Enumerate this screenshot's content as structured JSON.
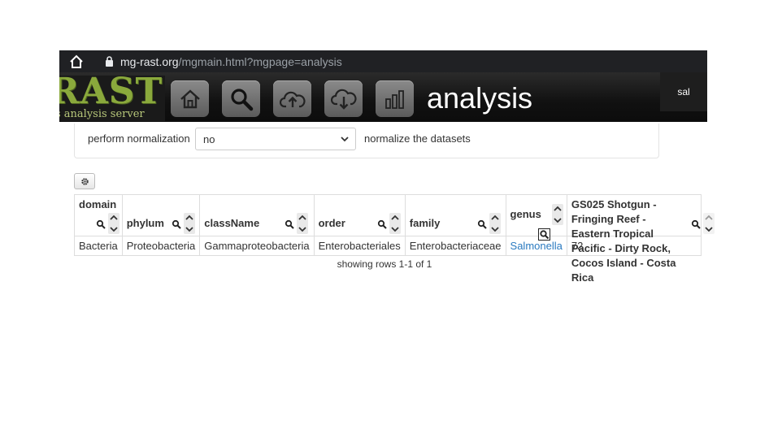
{
  "browser": {
    "url_host": "mg-rast.org",
    "url_path": "/mgmain.html?mgpage=analysis"
  },
  "header": {
    "logo_text": "RAST",
    "logo_subtitle": "s analysis server",
    "page_title": "analysis",
    "user": "sal",
    "nav_icons": [
      "home-icon",
      "search-icon",
      "upload-icon",
      "download-icon",
      "analysis-chart-icon"
    ]
  },
  "normalization": {
    "label": "perform normalization",
    "selected": "no",
    "description": "normalize the datasets"
  },
  "table": {
    "columns": [
      {
        "key": "domain",
        "label": "domain"
      },
      {
        "key": "phylum",
        "label": "phylum"
      },
      {
        "key": "className",
        "label": "className"
      },
      {
        "key": "order",
        "label": "order"
      },
      {
        "key": "family",
        "label": "family"
      },
      {
        "key": "genus",
        "label": "genus"
      },
      {
        "key": "sample",
        "label": "GS025 Shotgun - Fringing Reef - Eastern Tropical Pacific - Dirty Rock, Cocos Island - Costa Rica"
      }
    ],
    "rows": [
      {
        "domain": "Bacteria",
        "phylum": "Proteobacteria",
        "className": "Gammaproteobacteria",
        "order": "Enterobacteriales",
        "family": "Enterobacteriaceae",
        "genus": "Salmonella",
        "sample": "72"
      }
    ],
    "footer": "showing rows 1-1 of 1"
  },
  "colors": {
    "link": "#2a7ac0",
    "logo_green": "#8aa93c",
    "header_bg": "#111111"
  }
}
